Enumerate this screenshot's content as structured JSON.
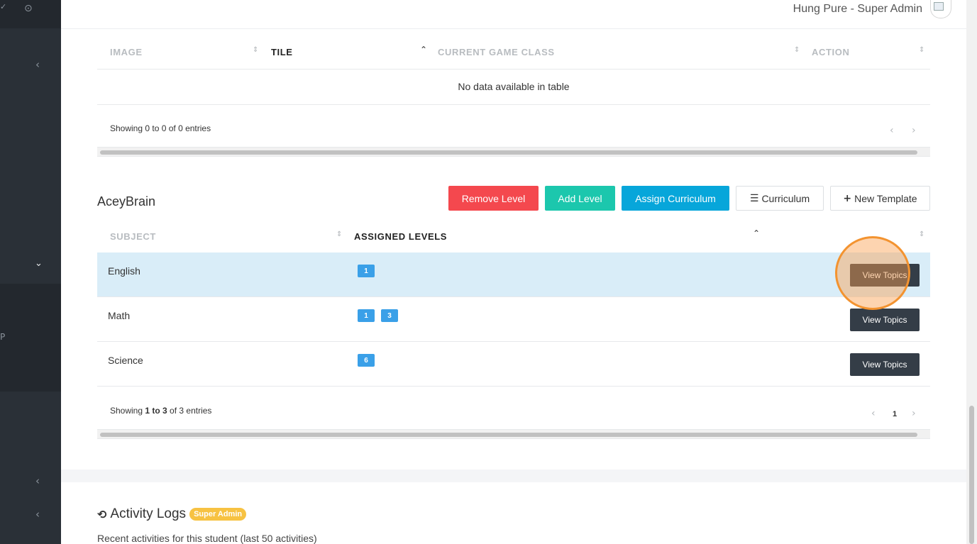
{
  "header": {
    "user_name": "Hung Pure - Super Admin"
  },
  "sidebar": {
    "icons": [
      "check-icon",
      "settings-icon",
      "chevron-left-icon",
      "chevron-down-icon",
      "chevron-left-icon",
      "chevron-left-icon"
    ],
    "partial_label": "P"
  },
  "tile_table": {
    "columns": [
      "IMAGE",
      "TILE",
      "CURRENT GAME CLASS",
      "ACTION"
    ],
    "empty_message": "No data available in table",
    "info": "Showing 0 to 0 of 0 entries",
    "prev": "‹",
    "next": "›"
  },
  "subject_section": {
    "title": "AceyBrain",
    "buttons": {
      "remove_level": "Remove Level",
      "add_level": "Add Level",
      "assign_curriculum": "Assign Curriculum",
      "curriculum": "Curriculum",
      "new_template": "New Template"
    },
    "columns": [
      "SUBJECT",
      "ASSIGNED LEVELS"
    ],
    "rows": [
      {
        "subject": "English",
        "levels": [
          "1"
        ],
        "action": "View Topics"
      },
      {
        "subject": "Math",
        "levels": [
          "1",
          "3"
        ],
        "action": "View Topics"
      },
      {
        "subject": "Science",
        "levels": [
          "6"
        ],
        "action": "View Topics"
      }
    ],
    "info_prefix": "Showing ",
    "info_range": "1 to 3",
    "info_suffix": " of 3 entries",
    "page": "1",
    "prev": "‹",
    "next": "›"
  },
  "activity": {
    "title": "Activity Logs",
    "badge": "Super Admin",
    "subtitle": "Recent activities for this student (last 50 activities)"
  },
  "colors": {
    "remove": "#f4484e",
    "add": "#1cc7ad",
    "assign": "#07a6da",
    "badge": "#3aa0e8",
    "view_button": "#343d47",
    "admin_badge": "#f7c242",
    "click_indicator": "#f39330"
  }
}
